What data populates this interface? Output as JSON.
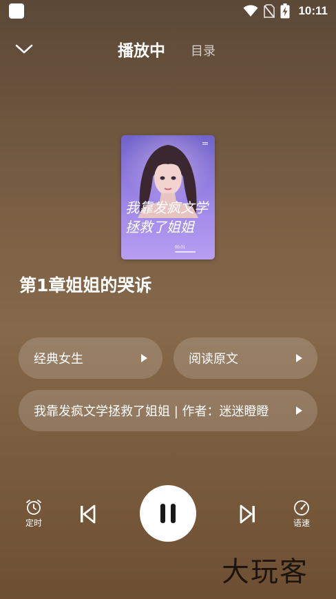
{
  "status_bar": {
    "time": "10:11",
    "icons": [
      "app-square-icon",
      "wifi-icon",
      "no-sim-icon",
      "battery-charging-icon"
    ]
  },
  "header": {
    "back_icon": "chevron-down-icon",
    "tab_playing": "播放中",
    "tab_catalog": "目录"
  },
  "cover": {
    "title_line1": "我靠发疯文学",
    "title_line2": "拯救了姐姐",
    "subtitle_number": "00.01"
  },
  "chapter_title": "第1章姐姐的哭诉",
  "pills": {
    "voice_label": "经典女生",
    "read_original_label": "阅读原文",
    "book_info_label": "我靠发疯文学拯救了姐姐 | 作者：迷迷瞪瞪"
  },
  "controls": {
    "timer_label": "定时",
    "speed_label": "语速",
    "state": "playing"
  },
  "watermark": "大玩客",
  "colors": {
    "background_top": "#5b4837",
    "background_bottom": "#6e4f33",
    "pill_bg": "rgba(255,255,255,0.16)",
    "pause_button_bg": "#ffffff"
  }
}
